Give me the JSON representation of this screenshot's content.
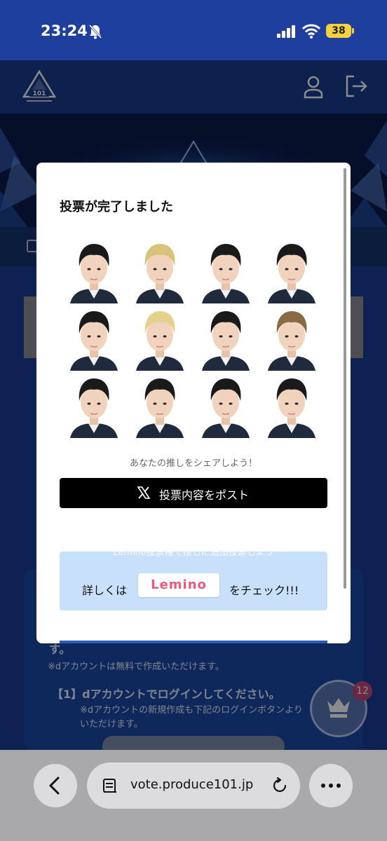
{
  "status_bar": {
    "time": "23:24",
    "battery": "38",
    "icons": [
      "bell-slash-icon",
      "signal-icon",
      "wifi-icon",
      "battery-icon"
    ]
  },
  "header": {
    "logo_text": "PRODUCE 101",
    "logo_sub": "JAPAN SHINSEKAI",
    "icons": [
      "user-icon",
      "logout-icon"
    ]
  },
  "background": {
    "line1": "す。",
    "line2": "※dアカウントは無料で作成いただけます。",
    "line3": "【1】dアカウントでログインしてください。",
    "line4": "※dアカウントの新規作成も下記のログインボタンより",
    "line5": "いただけます。",
    "fab_badge": "12"
  },
  "modal": {
    "title": "投票が完了しました",
    "share_caption": "あなたの推しをシェアしよう！",
    "post_button": "投票内容をポスト",
    "lemino_cut_text": "Lemino投票権で推しに追加投票しよう",
    "lemino_prefix": "詳しくは",
    "lemino_logo": "Lemino",
    "lemino_suffix": "をチェック!!!"
  },
  "browser": {
    "url": "vote.produce101.jp",
    "icons": [
      "back-icon",
      "page-icon",
      "reload-icon",
      "more-icon"
    ]
  },
  "colors": {
    "brand_blue": "#1b3f9c",
    "post_button": "#000000",
    "lemino_box": "#c9e0fb",
    "lemino_pink": "#e8597b"
  }
}
